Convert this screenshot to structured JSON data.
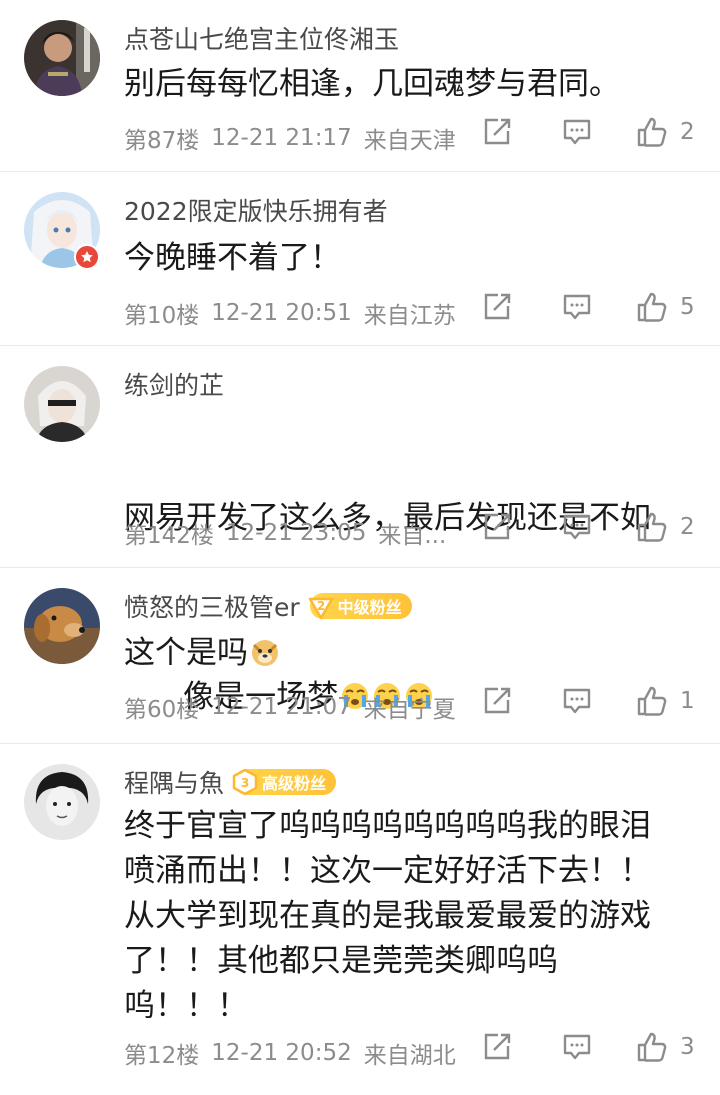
{
  "comments": [
    {
      "username": "点苍山七绝宫主位佟湘玉",
      "text": "别后每每忆相逢，几回魂梦与君同。",
      "floor": "第87楼",
      "time": "12-21 21:17",
      "location": "来自天津",
      "likes": "2",
      "avatar": "avatar-woman"
    },
    {
      "username": "2022限定版快乐拥有者",
      "text": "今晚睡不着了！",
      "floor": "第10楼",
      "time": "12-21 20:51",
      "location": "来自江苏",
      "likes": "5",
      "avatar": "avatar-anime-girl",
      "verified_badge": "red-star-badge"
    },
    {
      "username": "练剑的芷",
      "text_line1": "网易开发了这么多，最后发现还是不如",
      "text_line2": "这个是吗",
      "emoji": "doge-emoji",
      "floor": "第142楼",
      "time": "12-21 23:05",
      "location": "来自...",
      "likes": "2",
      "avatar": "avatar-white-hair"
    },
    {
      "username": "愤怒的三极管er",
      "fan_level": "2",
      "fan_label": "中级粉丝",
      "text": "像是一场梦",
      "emoji": "crying-emoji",
      "floor": "第60楼",
      "time": "12-21 21:07",
      "location": "来自宁夏",
      "likes": "1",
      "avatar": "avatar-dog"
    },
    {
      "username": "程隅与魚",
      "fan_level": "3",
      "fan_label": "高级粉丝",
      "text": "终于官宣了呜呜呜呜呜呜呜呜我的眼泪喷涌而出！！这次一定好好活下去！！从大学到现在真的是我最爱最爱的游戏了！！其他都只是莞莞类卿呜呜呜！！！",
      "floor": "第12楼",
      "time": "12-21 20:52",
      "location": "来自湖北",
      "likes": "3",
      "avatar": "avatar-bw-portrait"
    }
  ],
  "colors": {
    "name": "#4a4a4a",
    "meta": "#8c8c8c",
    "fan_badge": "#ffc23a",
    "verified": "#e8473a"
  }
}
